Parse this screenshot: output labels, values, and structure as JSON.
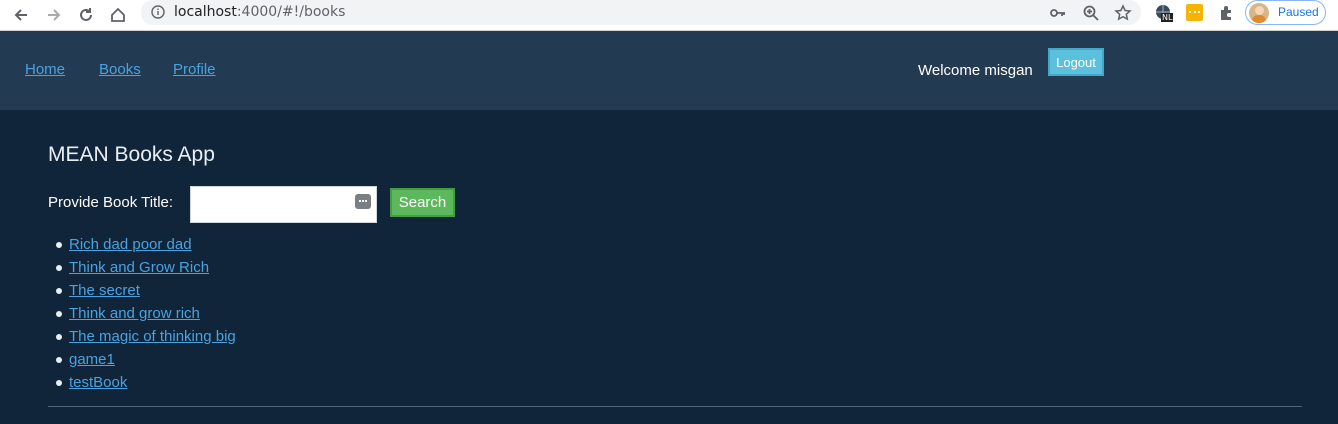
{
  "browser": {
    "url_host": "localhost",
    "url_path": ":4000/#!/books",
    "extension_badge": "NL",
    "profile_status": "Paused"
  },
  "navbar": {
    "links": [
      "Home",
      "Books",
      "Profile"
    ],
    "welcome": "Welcome misgan",
    "logout_label": "Logout"
  },
  "main": {
    "app_title": "MEAN Books App",
    "search_label": "Provide Book Title:",
    "search_value": "",
    "search_button": "Search",
    "books": [
      "Rich dad poor dad",
      "Think and Grow Rich",
      "The secret",
      "Think and grow rich",
      "The magic of thinking big",
      "game1",
      "testBook"
    ]
  },
  "colors": {
    "page_bg": "#10243a",
    "navbar_bg": "#223a52",
    "link": "#4aa3df",
    "logout_bg": "#5bc0de",
    "search_bg": "#5cb85c"
  }
}
